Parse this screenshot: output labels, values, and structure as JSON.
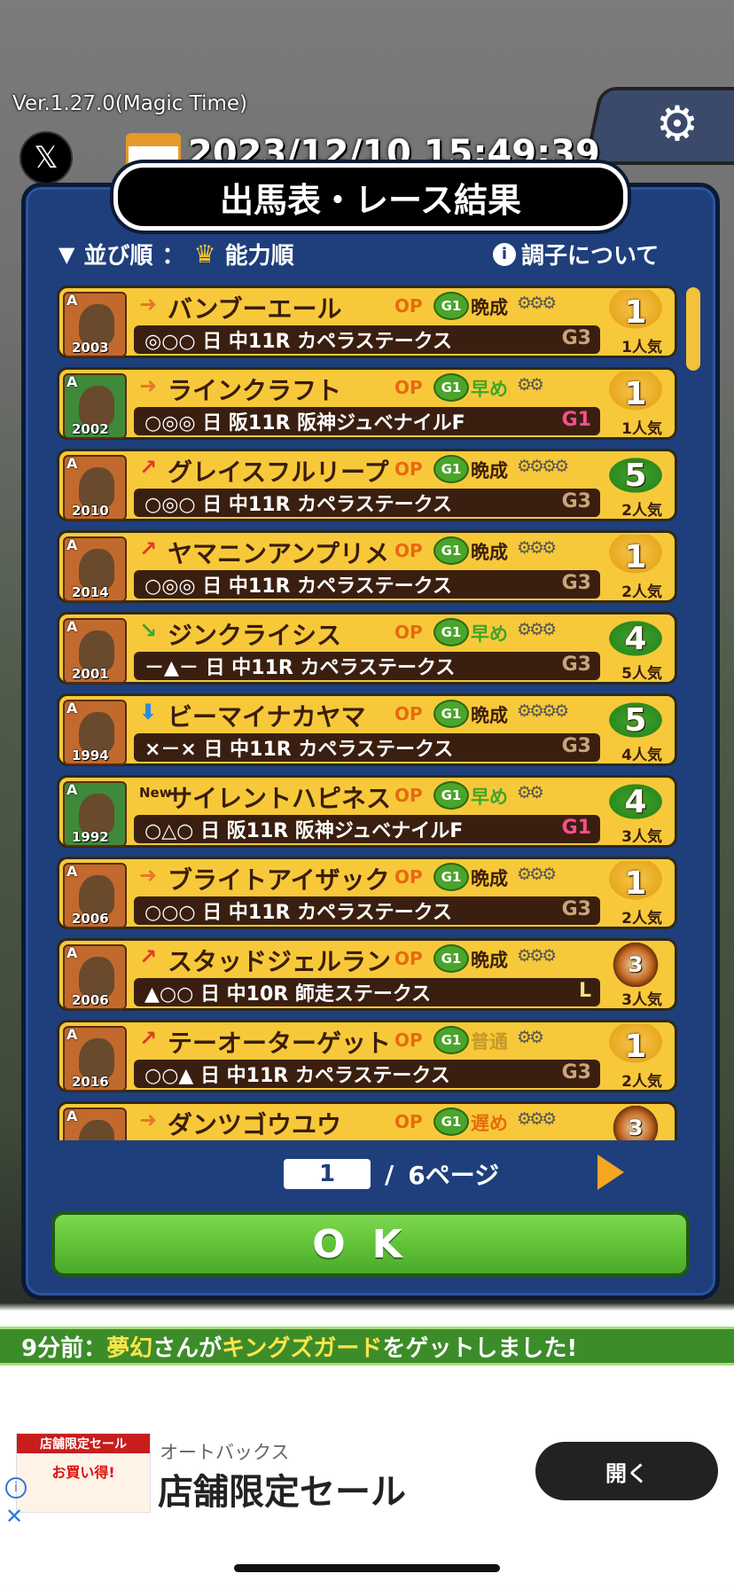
{
  "version": "Ver.1.27.0(Magic Time)",
  "datetime": "2023/12/10 15:49:39",
  "icons": {
    "x": "𝕏",
    "gear": "⚙",
    "info": "i",
    "triangle": "▼",
    "crown": "♛"
  },
  "title": "出馬表・レース結果",
  "sort": {
    "label": "並び順",
    "sep": "：",
    "value": "能力順"
  },
  "about_condition": "調子について",
  "rows": [
    {
      "rank": "A",
      "year": "2003",
      "arrow": "➜",
      "arrow_color": "#e8772a",
      "name": "バンブーエール",
      "op": "OP",
      "g1": "G1",
      "cond": "晩成",
      "cond_color": "#3a1d0a",
      "gears": "⚙⚙⚙",
      "marks": "◎○○ 日 中11R カペラステークス",
      "grade": "G3",
      "grade_color": "#c8a57a",
      "place": "1",
      "place_style": "cup",
      "pop": "1人気",
      "green": false
    },
    {
      "rank": "A",
      "year": "2002",
      "arrow": "➜",
      "arrow_color": "#e8772a",
      "name": "ラインクラフト",
      "op": "OP",
      "g1": "G1",
      "cond": "早め",
      "cond_color": "#3fa52e",
      "gears": "⚙⚙",
      "marks": "○◎◎ 日 阪11R 阪神ジュベナイルF",
      "grade": "G1",
      "grade_color": "#ff4d8d",
      "place": "1",
      "place_style": "cup",
      "pop": "1人気",
      "green": true
    },
    {
      "rank": "A",
      "year": "2010",
      "arrow": "↗",
      "arrow_color": "#e03a2a",
      "name": "グレイスフルリープ",
      "op": "OP",
      "g1": "G1",
      "cond": "晩成",
      "cond_color": "#3a1d0a",
      "gears": "⚙⚙⚙⚙",
      "marks": "○◎○ 日 中11R カペラステークス",
      "grade": "G3",
      "grade_color": "#c8a57a",
      "place": "5",
      "place_style": "leaf",
      "pop": "2人気",
      "green": false
    },
    {
      "rank": "A",
      "year": "2014",
      "arrow": "↗",
      "arrow_color": "#e03a2a",
      "name": "ヤマニンアンプリメ",
      "op": "OP",
      "g1": "G1",
      "cond": "晩成",
      "cond_color": "#3a1d0a",
      "gears": "⚙⚙⚙",
      "marks": "○◎◎ 日 中11R カペラステークス",
      "grade": "G3",
      "grade_color": "#c8a57a",
      "place": "1",
      "place_style": "cup",
      "pop": "2人気",
      "green": false
    },
    {
      "rank": "A",
      "year": "2001",
      "arrow": "↘",
      "arrow_color": "#3fa52e",
      "name": "ジンクライシス",
      "op": "OP",
      "g1": "G1",
      "cond": "早め",
      "cond_color": "#3fa52e",
      "gears": "⚙⚙⚙",
      "marks": "－▲－ 日 中11R カペラステークス",
      "grade": "G3",
      "grade_color": "#c8a57a",
      "place": "4",
      "place_style": "leaf",
      "pop": "5人気",
      "green": false
    },
    {
      "rank": "A",
      "year": "1994",
      "arrow": "⬇",
      "arrow_color": "#2a8ae0",
      "name": "ビーマイナカヤマ",
      "op": "OP",
      "g1": "G1",
      "cond": "晩成",
      "cond_color": "#3a1d0a",
      "gears": "⚙⚙⚙⚙",
      "marks": "×－× 日 中11R カペラステークス",
      "grade": "G3",
      "grade_color": "#c8a57a",
      "place": "5",
      "place_style": "leaf",
      "pop": "4人気",
      "green": false
    },
    {
      "rank": "A",
      "year": "1992",
      "arrow": "New",
      "arrow_color": "#3a1d0a",
      "name": "サイレントハピネス",
      "op": "OP",
      "g1": "G1",
      "cond": "早め",
      "cond_color": "#3fa52e",
      "gears": "⚙⚙",
      "marks": "○△○ 日 阪11R 阪神ジュベナイルF",
      "grade": "G1",
      "grade_color": "#ff4d8d",
      "place": "4",
      "place_style": "leaf",
      "pop": "3人気",
      "green": true
    },
    {
      "rank": "A",
      "year": "2006",
      "arrow": "➜",
      "arrow_color": "#e8772a",
      "name": "ブライトアイザック",
      "op": "OP",
      "g1": "G1",
      "cond": "晩成",
      "cond_color": "#3a1d0a",
      "gears": "⚙⚙⚙",
      "marks": "○○○ 日 中11R カペラステークス",
      "grade": "G3",
      "grade_color": "#c8a57a",
      "place": "1",
      "place_style": "cup",
      "pop": "2人気",
      "green": false
    },
    {
      "rank": "A",
      "year": "2006",
      "arrow": "↗",
      "arrow_color": "#e03a2a",
      "name": "スタッドジェルラン",
      "op": "OP",
      "g1": "G1",
      "cond": "晩成",
      "cond_color": "#3a1d0a",
      "gears": "⚙⚙⚙",
      "marks": "▲○○ 日 中10R 師走ステークス",
      "grade": "L",
      "grade_color": "#f3e08a",
      "place": "3",
      "place_style": "medal",
      "pop": "3人気",
      "green": false
    },
    {
      "rank": "A",
      "year": "2016",
      "arrow": "↗",
      "arrow_color": "#e03a2a",
      "name": "テーオーターゲット",
      "op": "OP",
      "g1": "G1",
      "cond": "普通",
      "cond_color": "#c49a2a",
      "gears": "⚙⚙",
      "marks": "○○▲ 日 中11R カペラステークス",
      "grade": "G3",
      "grade_color": "#c8a57a",
      "place": "1",
      "place_style": "cup",
      "pop": "2人気",
      "green": false
    },
    {
      "rank": "A",
      "year": "",
      "arrow": "➜",
      "arrow_color": "#e8772a",
      "name": "ダンツゴウユウ",
      "op": "OP",
      "g1": "G1",
      "cond": "遅め",
      "cond_color": "#e86a10",
      "gears": "⚙⚙⚙",
      "marks": "",
      "grade": "",
      "grade_color": "#c8a57a",
      "place": "3",
      "place_style": "medal",
      "pop": "",
      "green": false
    }
  ],
  "pager": {
    "current": "1",
    "sep": "/",
    "total": "6ページ"
  },
  "ok_label": "OK",
  "ticker": {
    "time": "9分前",
    "sep": "：",
    "user": "夢幻",
    "mid": "さんが",
    "item": "キングズガード",
    "end": "をゲットしました!"
  },
  "ad": {
    "image_top": "店舗限定セール",
    "image_mid": "お買い得!",
    "sponsor": "オートバックス",
    "title": "店舗限定セール",
    "button": "開く"
  }
}
